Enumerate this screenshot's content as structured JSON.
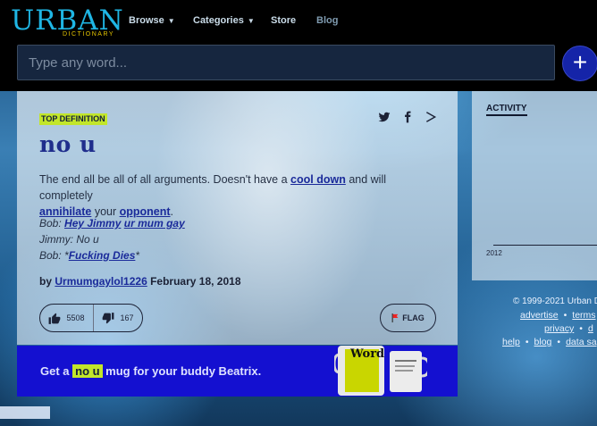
{
  "brand": {
    "logo_word": "URBAN",
    "logo_sub": "DICTIONARY"
  },
  "nav": {
    "browse": "Browse",
    "categories": "Categories",
    "store": "Store",
    "blog": "Blog"
  },
  "search": {
    "placeholder": "Type any word...",
    "add_label": "+"
  },
  "definition": {
    "badge": "TOP DEFINITION",
    "word": "no u",
    "meaning_prefix": "The end all be all of all arguments. Doesn't have a ",
    "meaning_link1": "cool down",
    "meaning_mid": " and will completely ",
    "meaning_link2": "annihilate",
    "meaning_mid2": " your ",
    "meaning_link3": "opponent",
    "meaning_end": ".",
    "example": {
      "line1_prefix": "Bob: ",
      "line1_link1": "Hey Jimmy",
      "line1_space": " ",
      "line1_link2": "ur mum gay",
      "line2": "Jimmy: No u",
      "line3_prefix": "Bob: *",
      "line3_link": "Fucking Dies",
      "line3_suffix": "*"
    },
    "by_label": "by",
    "author": "Urmumgaylol1226",
    "date": "February 18, 2018",
    "upvotes": "5508",
    "downvotes": "167",
    "flag_label": "FLAG",
    "share_icons": [
      "twitter-icon",
      "facebook-icon",
      "share-icon"
    ]
  },
  "mug": {
    "prefix": "Get a ",
    "word": "no u",
    "suffix": " mug for your buddy Beatrix.",
    "mug_word": "Word"
  },
  "activity": {
    "title": "ACTIVITY",
    "year": "2012"
  },
  "footer": {
    "copyright": "© 1999-2021 Urban D",
    "advertise": "advertise",
    "terms": "terms",
    "privacy": "privacy",
    "d": "d",
    "help": "help",
    "blog": "blog",
    "data": "data sa"
  },
  "colors": {
    "accent": "#c2e62a",
    "brand": "#1fb6e4",
    "banner": "#1410d0",
    "link": "#1a2a9a"
  }
}
